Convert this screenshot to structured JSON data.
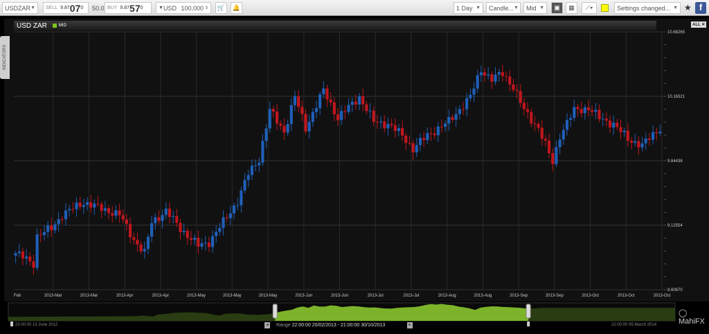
{
  "toolbar": {
    "symbol": "USDZAR",
    "sell_label": "SELL",
    "sell_prefix": "9.87",
    "sell_big": "07",
    "sell_sup": "0",
    "spread": "50.0",
    "buy_label": "BUY",
    "buy_prefix": "9.87",
    "buy_big": "57",
    "buy_sup": "0",
    "currency": "USD",
    "amount": "100,000",
    "interval": "1 Day",
    "chart_type": "Candle...",
    "price_type": "Mid",
    "settings": "Settings changed...",
    "highlight_color": "#ffff00"
  },
  "chart_header": {
    "title": "USD ZAR",
    "series_label": "MID",
    "all_button": "ALL ✕"
  },
  "side_tab": "INDICATORS",
  "chart_data": {
    "type": "candlestick",
    "title": "USD ZAR",
    "ylim": [
      8.6067,
      10.68265
    ],
    "y_ticks": [
      "10.68265",
      "10.16321",
      "9.64438",
      "9.12554",
      "8.60670"
    ],
    "y_tick_values": [
      10.68265,
      10.16321,
      9.64438,
      9.12554,
      8.6067
    ],
    "x_ticks": [
      "Feb",
      "2013-Mar",
      "2013-Mar",
      "2013-Apr",
      "2013-Apr",
      "2013-May",
      "2013-May",
      "2013-May",
      "2013-Jun",
      "2013-Jun",
      "2013-Jul",
      "2013-Jul",
      "2013-Aug",
      "2013-Aug",
      "2013-Sep",
      "2013-Sep",
      "2013-Oct",
      "2013-Oct",
      "2013-Oct"
    ],
    "n_candles": 181,
    "close_keypoints": [
      [
        0,
        8.9
      ],
      [
        5,
        8.82
      ],
      [
        6,
        9.04
      ],
      [
        10,
        9.1
      ],
      [
        13,
        9.21
      ],
      [
        19,
        9.31
      ],
      [
        23,
        9.27
      ],
      [
        29,
        9.21
      ],
      [
        33,
        9.01
      ],
      [
        36,
        8.9
      ],
      [
        38,
        9.15
      ],
      [
        42,
        9.24
      ],
      [
        46,
        9.1
      ],
      [
        51,
        8.96
      ],
      [
        54,
        8.99
      ],
      [
        58,
        9.15
      ],
      [
        62,
        9.32
      ],
      [
        65,
        9.54
      ],
      [
        68,
        9.66
      ],
      [
        71,
        10.05
      ],
      [
        75,
        9.88
      ],
      [
        78,
        10.16
      ],
      [
        81,
        9.91
      ],
      [
        86,
        10.21
      ],
      [
        90,
        9.99
      ],
      [
        96,
        10.16
      ],
      [
        100,
        9.96
      ],
      [
        104,
        9.94
      ],
      [
        108,
        9.85
      ],
      [
        111,
        9.74
      ],
      [
        115,
        9.85
      ],
      [
        121,
        9.96
      ],
      [
        127,
        10.16
      ],
      [
        130,
        10.38
      ],
      [
        133,
        10.3
      ],
      [
        136,
        10.35
      ],
      [
        139,
        10.24
      ],
      [
        142,
        10.05
      ],
      [
        146,
        9.91
      ],
      [
        150,
        9.63
      ],
      [
        152,
        9.85
      ],
      [
        156,
        10.05
      ],
      [
        160,
        10.07
      ],
      [
        163,
        9.99
      ],
      [
        167,
        9.94
      ],
      [
        171,
        9.82
      ],
      [
        175,
        9.77
      ],
      [
        180,
        9.91
      ]
    ],
    "up_color": "#1f5fb8",
    "down_color": "#c0161e"
  },
  "navigator": {
    "start": "22:00:00 13 June 2012",
    "range_label": "Range",
    "range": "22:00:00 20/02/2013 - 21:00:00 30/10/2013",
    "end": "22:00:00 05 March 2014",
    "selected_fraction": [
      0.4,
      0.78
    ]
  },
  "logo": "MahiFX"
}
